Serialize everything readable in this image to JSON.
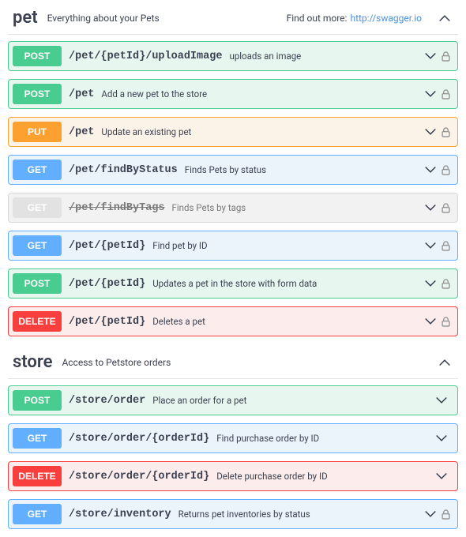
{
  "tags": [
    {
      "name": "pet",
      "description": "Everything about your Pets",
      "external_label": "Find out more:",
      "external_url_text": "http://swagger.io",
      "expanded": true,
      "operations": [
        {
          "method": "POST",
          "css": "post",
          "path": "/pet/{petId}/uploadImage",
          "summary": "uploads an image",
          "locked": true
        },
        {
          "method": "POST",
          "css": "post",
          "path": "/pet",
          "summary": "Add a new pet to the store",
          "locked": true
        },
        {
          "method": "PUT",
          "css": "put",
          "path": "/pet",
          "summary": "Update an existing pet",
          "locked": true
        },
        {
          "method": "GET",
          "css": "get",
          "path": "/pet/findByStatus",
          "summary": "Finds Pets by status",
          "locked": true
        },
        {
          "method": "GET",
          "css": "deprecated",
          "path": "/pet/findByTags",
          "summary": "Finds Pets by tags",
          "locked": true
        },
        {
          "method": "GET",
          "css": "get",
          "path": "/pet/{petId}",
          "summary": "Find pet by ID",
          "locked": true
        },
        {
          "method": "POST",
          "css": "post",
          "path": "/pet/{petId}",
          "summary": "Updates a pet in the store with form data",
          "locked": true
        },
        {
          "method": "DELETE",
          "css": "delete",
          "path": "/pet/{petId}",
          "summary": "Deletes a pet",
          "locked": true
        }
      ]
    },
    {
      "name": "store",
      "description": "Access to Petstore orders",
      "external_label": "",
      "external_url_text": "",
      "expanded": true,
      "operations": [
        {
          "method": "POST",
          "css": "post",
          "path": "/store/order",
          "summary": "Place an order for a pet",
          "locked": false
        },
        {
          "method": "GET",
          "css": "get",
          "path": "/store/order/{orderId}",
          "summary": "Find purchase order by ID",
          "locked": false
        },
        {
          "method": "DELETE",
          "css": "delete",
          "path": "/store/order/{orderId}",
          "summary": "Delete purchase order by ID",
          "locked": false
        },
        {
          "method": "GET",
          "css": "get",
          "path": "/store/inventory",
          "summary": "Returns pet inventories by status",
          "locked": true
        }
      ]
    }
  ]
}
